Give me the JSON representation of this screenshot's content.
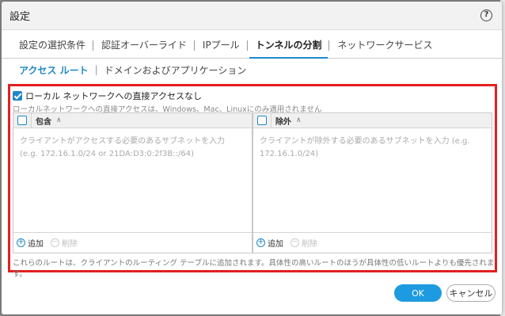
{
  "dialog": {
    "title": "設定",
    "help_icon": "?"
  },
  "tabs": [
    {
      "label": "設定の選択条件"
    },
    {
      "label": "認証オーバーライド"
    },
    {
      "label": "IPプール"
    },
    {
      "label": "トンネルの分割"
    },
    {
      "label": "ネットワークサービス"
    }
  ],
  "subtabs": [
    {
      "label": "アクセス ルート"
    },
    {
      "label": "ドメインおよびアプリケーション"
    }
  ],
  "panel": {
    "no_direct_access_label": "ローカル ネットワークへの直接アクセスなし",
    "no_direct_access_checked": true,
    "note": "ローカルネットワークへの直接アクセスは、Windows、Mac、Linuxにのみ適用されません",
    "include": {
      "title": "包含",
      "sort_icon": "∧",
      "placeholder": "クライアントがアクセスする必要のあるサブネットを入力 (e.g. 172.16.1.0/24 or 21DA:D3:0:2f3B::/64)",
      "add_label": "追加",
      "delete_label": "削除"
    },
    "exclude": {
      "title": "除外",
      "sort_icon": "∧",
      "placeholder": "クライアントが除外する必要のあるサブネットを入力 (e.g. 172.16.1.0/24)",
      "add_label": "追加",
      "delete_label": "削除"
    },
    "bottom_note": "これらのルートは、クライアントのルーティング テーブルに追加されます。具体性の高いルートのほうが具体性の低いルートよりも優先されます。"
  },
  "actions": {
    "ok_label": "OK",
    "cancel_label": "キャンセル"
  },
  "colors": {
    "accent": "#1e88c7",
    "ok_button": "#1e9ae0",
    "highlight_border": "#e32020"
  }
}
